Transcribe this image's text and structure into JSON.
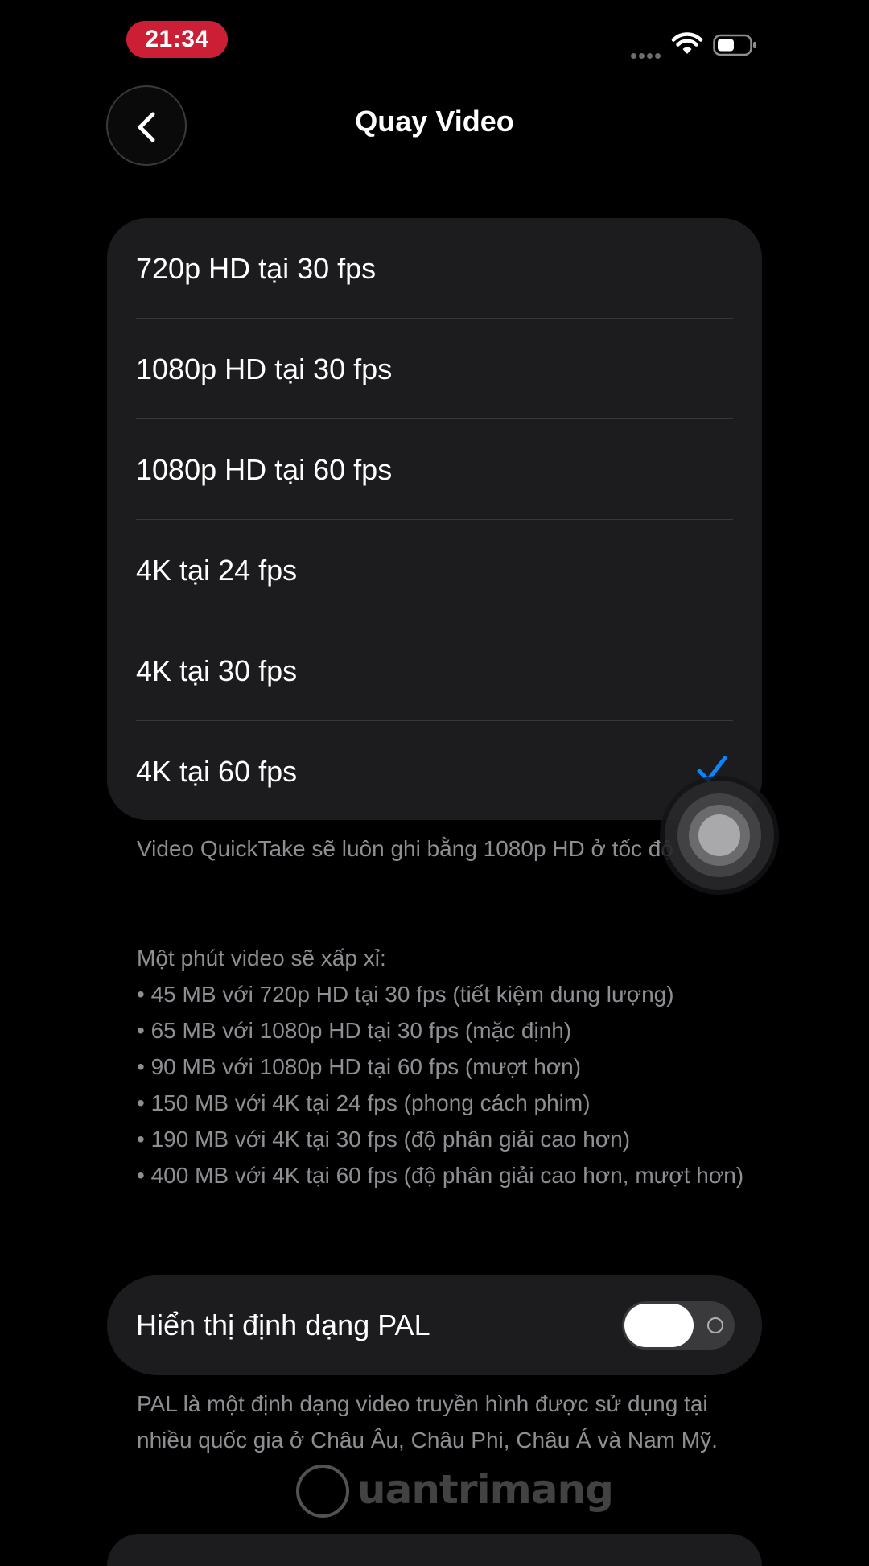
{
  "status_bar": {
    "time": "21:34"
  },
  "nav": {
    "title": "Quay Video"
  },
  "options": [
    {
      "label": "720p HD tại 30 fps",
      "selected": false
    },
    {
      "label": "1080p HD tại 30 fps",
      "selected": false
    },
    {
      "label": "1080p HD tại 60 fps",
      "selected": false
    },
    {
      "label": "4K tại 24 fps",
      "selected": false
    },
    {
      "label": "4K tại 30 fps",
      "selected": false
    },
    {
      "label": "4K tại 60 fps",
      "selected": true
    }
  ],
  "quicktake_note": "Video QuickTake sẽ luôn ghi bằng 1080p HD ở tốc độ 30 fps.",
  "size_note": {
    "heading": "Một phút video sẽ xấp xỉ:",
    "items": [
      "• 45 MB với 720p HD tại 30 fps (tiết kiệm dung lượng)",
      "• 65 MB với 1080p HD tại 30 fps (mặc định)",
      "• 90 MB với 1080p HD tại 60 fps (mượt hơn)",
      "• 150 MB với 4K tại 24 fps (phong cách phim)",
      "• 190 MB với 4K tại 30 fps (độ phân giải cao hơn)",
      "• 400 MB với 4K tại 60 fps (độ phân giải cao hơn, mượt hơn)"
    ]
  },
  "pal": {
    "label": "Hiển thị định dạng PAL",
    "enabled": false,
    "description": "PAL là một định dạng video truyền hình được sử dụng tại nhiều quốc gia ở Châu Âu, Châu Phi, Châu Á và Nam Mỹ."
  },
  "watermark": {
    "text": "uantrimang"
  },
  "colors": {
    "background": "#000000",
    "group_background": "#1c1c1e",
    "accent": "#0a84ff",
    "secondary_text": "#8e8e93",
    "time_pill": "#cc1f35"
  }
}
